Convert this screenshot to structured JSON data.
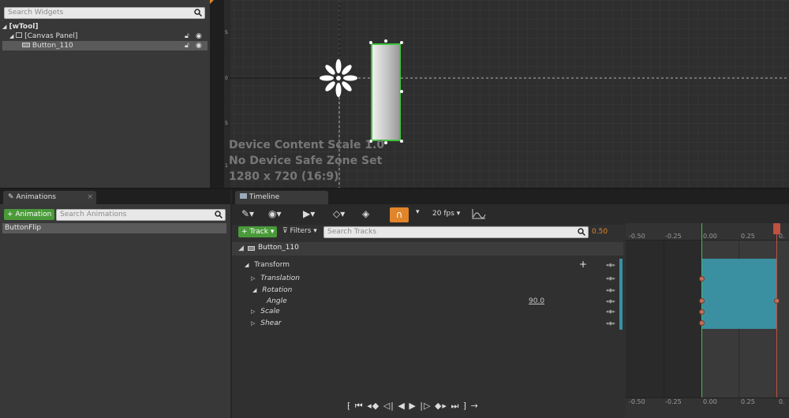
{
  "hierarchy": {
    "search_placeholder": "Search Widgets",
    "root": "[wTool]",
    "canvas": "[Canvas Panel]",
    "button": "Button_110"
  },
  "designer": {
    "scale_text": "Device Content Scale 1.0",
    "safezone_text": "No Device Safe Zone Set",
    "resolution_text": "1280 x 720 (16:9)",
    "ruler_labels": [
      "5",
      "0",
      "0",
      "5",
      "0",
      "1",
      "0",
      "0"
    ]
  },
  "animations": {
    "tab_label": "Animations",
    "add_label": "+ Animation",
    "search_placeholder": "Search Animations",
    "items": [
      "ButtonFlip"
    ]
  },
  "timeline": {
    "tab_label": "Timeline",
    "fps_label": "20 fps",
    "track_button": "+ Track",
    "filters_button": "Filters",
    "search_placeholder": "Search Tracks",
    "current_time": "0.50",
    "rows": {
      "widget": "Button_110",
      "transform": "Transform",
      "translation": "Translation",
      "rotation": "Rotation",
      "angle": "Angle",
      "angle_value": "90.0",
      "scale": "Scale",
      "shear": "Shear"
    },
    "ruler_top": [
      "-0.50",
      "-0.25",
      "0.00",
      "0.25",
      "0."
    ],
    "ruler_bottom": [
      "-0.50",
      "-0.25",
      "0.00",
      "0.25",
      "0."
    ]
  },
  "colors": {
    "accent_orange": "#e0852a",
    "section_teal": "#3a8fa0",
    "selection_green": "#3ec43e"
  }
}
